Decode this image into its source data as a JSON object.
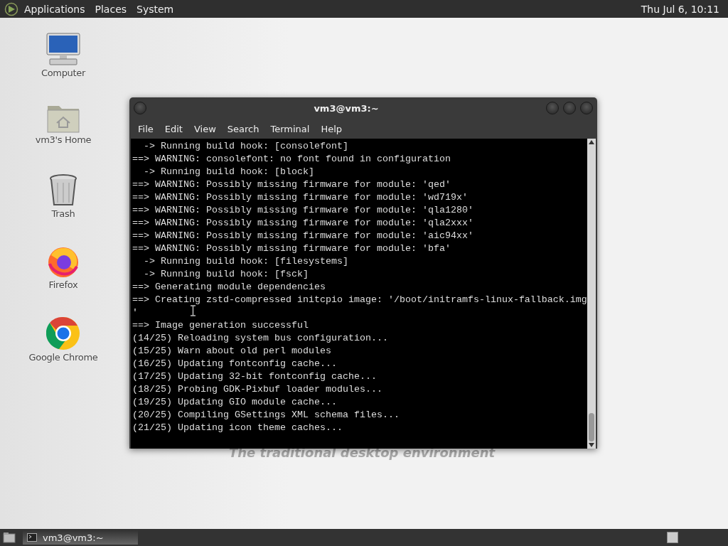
{
  "top_panel": {
    "menus": [
      "Applications",
      "Places",
      "System"
    ],
    "clock": "Thu Jul  6, 10:11"
  },
  "desktop_icons": [
    {
      "kind": "computer",
      "label": "Computer"
    },
    {
      "kind": "home",
      "label": "vm3's Home"
    },
    {
      "kind": "trash",
      "label": "Trash"
    },
    {
      "kind": "firefox",
      "label": "Firefox"
    },
    {
      "kind": "chrome",
      "label": "Google Chrome"
    }
  ],
  "wallpaper_text": "The traditional desktop environment",
  "terminal": {
    "title": "vm3@vm3:~",
    "menu": [
      "File",
      "Edit",
      "View",
      "Search",
      "Terminal",
      "Help"
    ],
    "lines": [
      "  -> Running build hook: [consolefont]",
      "==> WARNING: consolefont: no font found in configuration",
      "  -> Running build hook: [block]",
      "==> WARNING: Possibly missing firmware for module: 'qed'",
      "==> WARNING: Possibly missing firmware for module: 'wd719x'",
      "==> WARNING: Possibly missing firmware for module: 'qla1280'",
      "==> WARNING: Possibly missing firmware for module: 'qla2xxx'",
      "==> WARNING: Possibly missing firmware for module: 'aic94xx'",
      "==> WARNING: Possibly missing firmware for module: 'bfa'",
      "  -> Running build hook: [filesystems]",
      "  -> Running build hook: [fsck]",
      "==> Generating module dependencies",
      "==> Creating zstd-compressed initcpio image: '/boot/initramfs-linux-fallback.img",
      "'",
      "==> Image generation successful",
      "(14/25) Reloading system bus configuration...",
      "(15/25) Warn about old perl modules",
      "(16/25) Updating fontconfig cache...",
      "(17/25) Updating 32-bit fontconfig cache...",
      "(18/25) Probing GDK-Pixbuf loader modules...",
      "(19/25) Updating GIO module cache...",
      "(20/25) Compiling GSettings XML schema files...",
      "(21/25) Updating icon theme caches..."
    ]
  },
  "taskbar": {
    "tasks": [
      {
        "label": "vm3@vm3:~",
        "selected": true
      }
    ]
  }
}
